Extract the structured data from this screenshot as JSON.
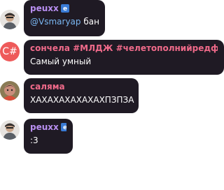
{
  "messages": [
    {
      "sender": "peuxx",
      "mention": "@Vsmaryap",
      "text": " бан",
      "avatar_icon": "user-photo",
      "badge_icon": "edge-browser-icon"
    },
    {
      "sender": "сончела #МЛДЖ #челетополнийредфла...",
      "text": "Самый умный",
      "avatar_label": "C#"
    },
    {
      "sender": "саляма",
      "text": "ХАХАХАХАХАХАХПЗПЗА",
      "avatar_icon": "user-photo"
    },
    {
      "sender": "peuxx",
      "text": ":3",
      "avatar_icon": "user-photo",
      "badge_icon": "edge-browser-icon"
    }
  ],
  "colors": {
    "bubble": "#1f1a24",
    "sender_violet": "#b98ff2",
    "sender_pink": "#f06a8a",
    "mention": "#7ab7f2",
    "avatar_cs": "#ee5a5a"
  }
}
